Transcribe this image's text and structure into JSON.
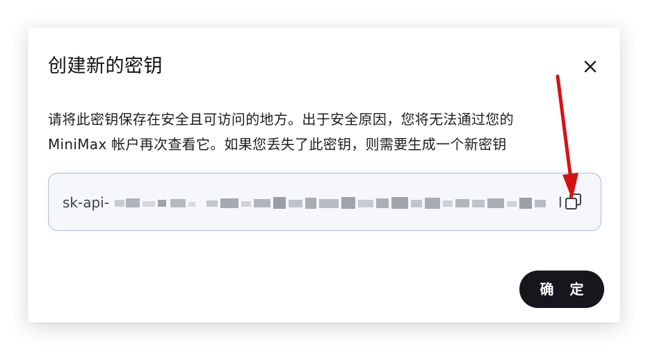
{
  "dialog": {
    "title": "创建新的密钥",
    "description_line1": "请将此密钥保存在安全且可访问的地方。出于安全原因，您将无法通过您的",
    "description_line2": "MiniMax 帐户再次查看它。如果您丢失了此密钥，则需要生成一个新密钥",
    "key": {
      "prefix": "sk-api-",
      "value_hidden": "blurred",
      "end_char": "l"
    },
    "confirm_label": "确 定"
  },
  "icons": {
    "close": "close-icon",
    "copy": "copy-icon"
  },
  "annotation": {
    "color": "#d51313"
  },
  "colors": {
    "button_bg": "#15171c",
    "input_border": "#a9b9d6",
    "input_bg": "#f5f7fb"
  }
}
